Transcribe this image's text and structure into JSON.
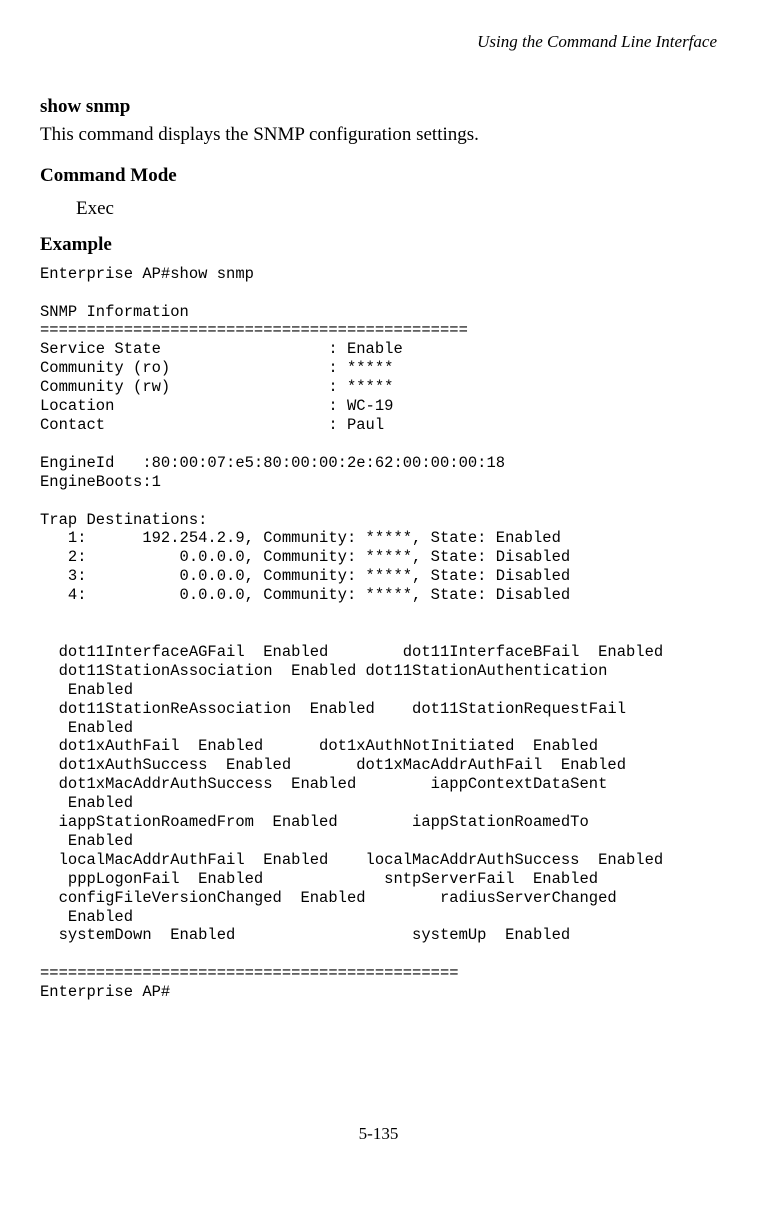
{
  "header": {
    "context": "Using the Command Line Interface"
  },
  "command": {
    "name": "show snmp",
    "description": "This command displays the SNMP configuration settings."
  },
  "sections": {
    "mode_head": "Command Mode",
    "mode_value": "Exec",
    "example_head": "Example"
  },
  "cli_lines": [
    "Enterprise AP#show snmp",
    "",
    "SNMP Information",
    "==============================================",
    "Service State                  : Enable",
    "Community (ro)                 : *****",
    "Community (rw)                 : *****",
    "Location                       : WC-19",
    "Contact                        : Paul",
    "",
    "EngineId   :80:00:07:e5:80:00:00:2e:62:00:00:00:18",
    "EngineBoots:1",
    "",
    "Trap Destinations:",
    "   1:      192.254.2.9, Community: *****, State: Enabled",
    "   2:          0.0.0.0, Community: *****, State: Disabled",
    "   3:          0.0.0.0, Community: *****, State: Disabled",
    "   4:          0.0.0.0, Community: *****, State: Disabled",
    "",
    "",
    "  dot11InterfaceAGFail  Enabled        dot11InterfaceBFail  Enabled",
    "  dot11StationAssociation  Enabled dot11StationAuthentication",
    "   Enabled",
    "  dot11StationReAssociation  Enabled    dot11StationRequestFail",
    "   Enabled",
    "  dot1xAuthFail  Enabled      dot1xAuthNotInitiated  Enabled",
    "  dot1xAuthSuccess  Enabled       dot1xMacAddrAuthFail  Enabled",
    "  dot1xMacAddrAuthSuccess  Enabled        iappContextDataSent",
    "   Enabled",
    "  iappStationRoamedFrom  Enabled        iappStationRoamedTo",
    "   Enabled",
    "  localMacAddrAuthFail  Enabled    localMacAddrAuthSuccess  Enabled",
    "   pppLogonFail  Enabled             sntpServerFail  Enabled",
    "  configFileVersionChanged  Enabled        radiusServerChanged",
    "   Enabled",
    "  systemDown  Enabled                   systemUp  Enabled",
    "",
    "=============================================",
    "Enterprise AP#"
  ],
  "footer": {
    "page_number": "5-135"
  }
}
